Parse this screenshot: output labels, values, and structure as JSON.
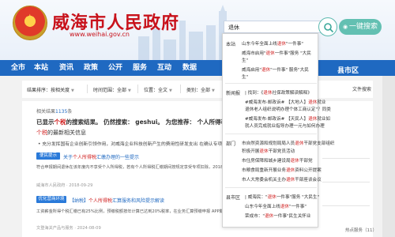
{
  "header": {
    "site_title": "威海市人民政府",
    "site_url": "www.weihai.gov.cn",
    "search_value": "退休",
    "quick_search_label": "一键搜索"
  },
  "nav": [
    "全市",
    "本站",
    "资讯",
    "政策",
    "公开",
    "服务",
    "互动",
    "数据"
  ],
  "nav_right": "县市区",
  "filter": {
    "sort_label": "结果排序：",
    "sort_value": "按相关度",
    "time_label": "时间范围：",
    "time_value": "全部",
    "position_label": "位置：",
    "position_value": "全文",
    "type_label": "类别：",
    "type_value": "全部",
    "fold_label": "文件搜索"
  },
  "results": {
    "count_prefix": "相关结果",
    "count_value": "1135",
    "count_suffix": "条",
    "notice1_a": "已显示",
    "notice1_r": "个税",
    "notice1_b": "的搜索结果。 仍然搜索： geshui。 为您推荐： 个人所得税。",
    "notice2_r": "个税",
    "notice2_b": "的最新相关信息",
    "notice3": "• 充分发挥国有企业创新引领作用，对威海企业科技创新产生的费用性研发支出 在确认专项",
    "items": [
      {
        "tag": "便民提示",
        "title_a": "关于",
        "title_r": "个人所得税",
        "title_b": "汇缴办理的一些提示",
        "body": "符合申报期间退休在该年度内不享受个人所得税，若有个人所得税汇缴期间按规定享受专项扣除，2018年",
        "meta": "威海市人民政府 · 2018-09-29"
      },
      {
        "tag": "优化营商环境",
        "title_a": "【纳税】",
        "title_r": "个人所得税",
        "title_b": "汇算服务和风险提示解读",
        "body": "工资薪金所得个税汇缴已有25%比例，预缴税额按年计算已达到20%税率，在业务汇算预缴申报 APP期间按专门",
        "meta": "文登海关产品与服务 · 2024-08-09"
      }
    ]
  },
  "side": {
    "footer": "热点服务（11）"
  },
  "dropdown": {
    "sections": [
      {
        "name": "本站",
        "items": [
          {
            "a": "山东今年全面上线",
            "r": "退休",
            "b": "\"一件事\""
          },
          {
            "a": "威海市启用\"",
            "r": "退休",
            "b": "一件事\"服务 \"大民"
          },
          {
            "a": "生\"",
            "r": "",
            "b": ""
          },
          {
            "a": "威海启用\"",
            "r": "退休",
            "b": "\"一件事\" 服务\"大民"
          },
          {
            "a": "生\"",
            "r": "",
            "b": ""
          }
        ]
      },
      {
        "name": "新闻报",
        "items": [
          {
            "a": "| 找到：《",
            "r": "退休",
            "b": "社保政策解读解释》"
          },
          {
            "a": "#威海发布·邮政诉# 【大地人】",
            "r": "退休",
            "b": "就业"
          },
          {
            "a": "退休老人组织说明办理个体工商认定\"？同类",
            "r": "",
            "b": ""
          },
          {
            "a": "#威海发布·邮政诉# 【天民人】",
            "r": "退休",
            "b": "就业如"
          },
          {
            "a": "就人员完成就业指导办理一元与如何办理",
            "r": "",
            "b": ""
          }
        ]
      },
      {
        "name": "部门",
        "items": [
          {
            "a": "市自然资源和规划局局人员",
            "r": "退休",
            "b": "干部党支部组织"
          },
          {
            "a": "积极开展",
            "r": "退休",
            "b": "干部党员活动"
          },
          {
            "a": "市住房保障和城乡建设局",
            "r": "退休",
            "b": "干部党"
          },
          {
            "a": "市粮食局重新开展业务",
            "r": "退休",
            "b": "资料公开提案"
          },
          {
            "a": "市人大常委会机关主办",
            "r": "退休",
            "b": "干部座谈会议"
          }
        ]
      },
      {
        "name": "县市区",
        "items": [
          {
            "a": "| 威海民：\"",
            "r": "退休",
            "b": "一件事\"服务 \"大民生\""
          },
          {
            "a": "山东今年全面上线",
            "r": "退休",
            "b": "\"一件事\""
          },
          {
            "a": "荣成市：\"",
            "r": "退休",
            "b": "一件事\"民生关怀业"
          }
        ]
      }
    ]
  }
}
